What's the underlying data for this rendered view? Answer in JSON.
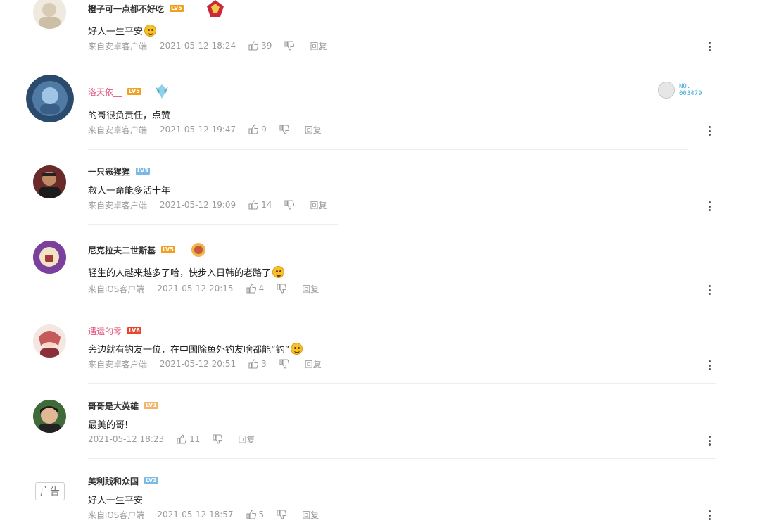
{
  "comments": [
    {
      "user": "橙子可一点都不好吃",
      "level": "LV5",
      "text": "好人一生平安",
      "source": "来自安卓客户端",
      "time": "2021-05-12 18:24",
      "likes": "39",
      "reply": "回复",
      "has_emoji": true
    },
    {
      "user": "洛天依__",
      "level": "LV5",
      "text": "的哥很负责任，点赞",
      "source": "来自安卓客户端",
      "time": "2021-05-12 19:47",
      "likes": "9",
      "reply": "回复",
      "badge_number": "NO.\n003479"
    },
    {
      "user": "一只恶猩猩",
      "level": "LV3",
      "text": "救人一命能多活十年",
      "source": "来自安卓客户端",
      "time": "2021-05-12 19:09",
      "likes": "14",
      "reply": "回复"
    },
    {
      "user": "尼克拉夫二世斯基",
      "level": "LV5",
      "text": "轻生的人越来越多了哈，快步入日韩的老路了",
      "source": "来自iOS客户端",
      "time": "2021-05-12 20:15",
      "likes": "4",
      "reply": "回复",
      "has_emoji": true
    },
    {
      "user": "遇运的零",
      "level": "LV6",
      "text": "旁边就有钓友一位，在中国除鱼外钓友啥都能“钓”",
      "source": "来自安卓客户端",
      "time": "2021-05-12 20:51",
      "likes": "3",
      "reply": "回复",
      "has_emoji": true
    },
    {
      "user": "哥哥是大英雄",
      "level": "LV1",
      "text": "最美的哥!",
      "source": "",
      "time": "2021-05-12 18:23",
      "likes": "11",
      "reply": "回复"
    },
    {
      "user": "美利践和众国",
      "level": "LV3",
      "text": "好人一生平安",
      "source": "来自iOS客户端",
      "time": "2021-05-12 18:57",
      "likes": "5",
      "reply": "回复",
      "ad_label": "广告"
    }
  ],
  "colors": {
    "lv5": "#f0a020",
    "lv3": "#7ab8e6",
    "lv6": "#e8432e",
    "lv1": "#f2b36a",
    "meta": "#9a9a9a",
    "pink_name": "#e0567d"
  },
  "icons": [
    "avatar",
    "medal-icon",
    "like-icon",
    "dislike-icon",
    "more-icon",
    "emoji-icon"
  ]
}
